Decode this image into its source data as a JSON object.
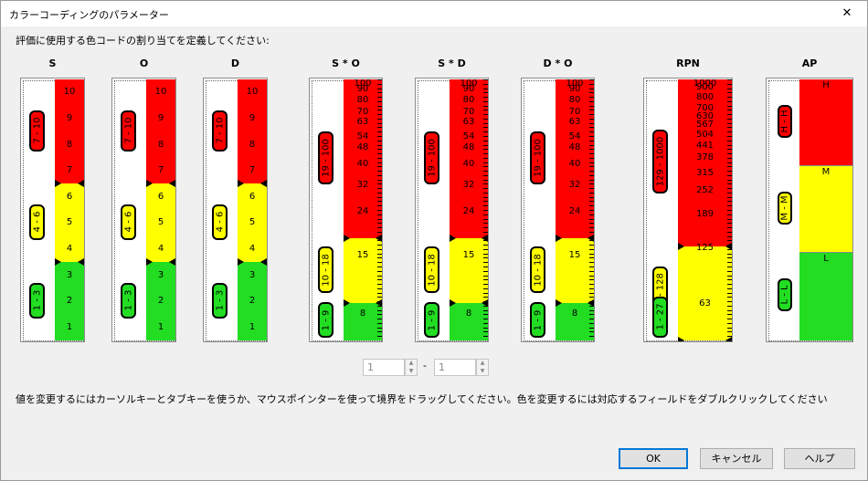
{
  "window": {
    "title": "カラーコーディングのパラメーター",
    "close_glyph": "✕"
  },
  "instruction": "評価に使用する色コードの割り当てを定義してください:",
  "colors": {
    "red": "#ff0000",
    "yellow": "#ffff00",
    "green": "#22dd22"
  },
  "scales": [
    {
      "name": "S",
      "max": 10,
      "min": 0,
      "segments": [
        {
          "from": 0,
          "to": 3,
          "color": "green"
        },
        {
          "from": 3,
          "to": 6,
          "color": "yellow"
        },
        {
          "from": 6,
          "to": 10,
          "color": "red"
        }
      ],
      "labels": [
        {
          "v": 0.5,
          "t": "1"
        },
        {
          "v": 1.5,
          "t": "2"
        },
        {
          "v": 2.5,
          "t": "3"
        },
        {
          "v": 3.5,
          "t": "4"
        },
        {
          "v": 4.5,
          "t": "5"
        },
        {
          "v": 5.5,
          "t": "6"
        },
        {
          "v": 6.5,
          "t": "7"
        },
        {
          "v": 7.5,
          "t": "8"
        },
        {
          "v": 8.5,
          "t": "9"
        },
        {
          "v": 9.5,
          "t": "10"
        }
      ],
      "ranges": [
        {
          "text": "7 - 10",
          "color": "red",
          "from": 6,
          "to": 10
        },
        {
          "text": "4 - 6",
          "color": "yellow",
          "from": 3,
          "to": 6
        },
        {
          "text": "1 - 3",
          "color": "green",
          "from": 0,
          "to": 3
        }
      ]
    },
    {
      "name": "O",
      "max": 10,
      "min": 0,
      "segments": [
        {
          "from": 0,
          "to": 3,
          "color": "green"
        },
        {
          "from": 3,
          "to": 6,
          "color": "yellow"
        },
        {
          "from": 6,
          "to": 10,
          "color": "red"
        }
      ],
      "labels": [
        {
          "v": 0.5,
          "t": "1"
        },
        {
          "v": 1.5,
          "t": "2"
        },
        {
          "v": 2.5,
          "t": "3"
        },
        {
          "v": 3.5,
          "t": "4"
        },
        {
          "v": 4.5,
          "t": "5"
        },
        {
          "v": 5.5,
          "t": "6"
        },
        {
          "v": 6.5,
          "t": "7"
        },
        {
          "v": 7.5,
          "t": "8"
        },
        {
          "v": 8.5,
          "t": "9"
        },
        {
          "v": 9.5,
          "t": "10"
        }
      ],
      "ranges": [
        {
          "text": "7 - 10",
          "color": "red",
          "from": 6,
          "to": 10
        },
        {
          "text": "4 - 6",
          "color": "yellow",
          "from": 3,
          "to": 6
        },
        {
          "text": "1 - 3",
          "color": "green",
          "from": 0,
          "to": 3
        }
      ]
    },
    {
      "name": "D",
      "max": 10,
      "min": 0,
      "segments": [
        {
          "from": 0,
          "to": 3,
          "color": "green"
        },
        {
          "from": 3,
          "to": 6,
          "color": "yellow"
        },
        {
          "from": 6,
          "to": 10,
          "color": "red"
        }
      ],
      "labels": [
        {
          "v": 0.5,
          "t": "1"
        },
        {
          "v": 1.5,
          "t": "2"
        },
        {
          "v": 2.5,
          "t": "3"
        },
        {
          "v": 3.5,
          "t": "4"
        },
        {
          "v": 4.5,
          "t": "5"
        },
        {
          "v": 5.5,
          "t": "6"
        },
        {
          "v": 6.5,
          "t": "7"
        },
        {
          "v": 7.5,
          "t": "8"
        },
        {
          "v": 8.5,
          "t": "9"
        },
        {
          "v": 9.5,
          "t": "10"
        }
      ],
      "ranges": [
        {
          "text": "7 - 10",
          "color": "red",
          "from": 6,
          "to": 10
        },
        {
          "text": "4 - 6",
          "color": "yellow",
          "from": 3,
          "to": 6
        },
        {
          "text": "1 - 3",
          "color": "green",
          "from": 0,
          "to": 3
        }
      ]
    },
    {
      "name": "S * O",
      "max": 100,
      "min": 0,
      "log": true,
      "segments": [
        {
          "from": 0,
          "to": 9,
          "color": "green"
        },
        {
          "from": 9,
          "to": 18,
          "color": "yellow"
        },
        {
          "from": 18,
          "to": 100,
          "color": "red"
        }
      ],
      "labels": [
        {
          "v": 100,
          "t": "100"
        },
        {
          "v": 90,
          "t": "90"
        },
        {
          "v": 80,
          "t": "80"
        },
        {
          "v": 70,
          "t": "70"
        },
        {
          "v": 63,
          "t": "63"
        },
        {
          "v": 54,
          "t": "54"
        },
        {
          "v": 48,
          "t": "48"
        },
        {
          "v": 40,
          "t": "40"
        },
        {
          "v": 32,
          "t": "32"
        },
        {
          "v": 24,
          "t": "24"
        },
        {
          "v": 15,
          "t": "15"
        },
        {
          "v": 8,
          "t": "8"
        }
      ],
      "ranges": [
        {
          "text": "19 - 100",
          "color": "red",
          "from": 18,
          "to": 100
        },
        {
          "text": "10 - 18",
          "color": "yellow",
          "from": 9,
          "to": 18
        },
        {
          "text": "1 - 9",
          "color": "green",
          "from": 0,
          "to": 9
        }
      ]
    },
    {
      "name": "S * D",
      "max": 100,
      "min": 0,
      "log": true,
      "segments": [
        {
          "from": 0,
          "to": 9,
          "color": "green"
        },
        {
          "from": 9,
          "to": 18,
          "color": "yellow"
        },
        {
          "from": 18,
          "to": 100,
          "color": "red"
        }
      ],
      "labels": [
        {
          "v": 100,
          "t": "100"
        },
        {
          "v": 90,
          "t": "90"
        },
        {
          "v": 80,
          "t": "80"
        },
        {
          "v": 70,
          "t": "70"
        },
        {
          "v": 63,
          "t": "63"
        },
        {
          "v": 54,
          "t": "54"
        },
        {
          "v": 48,
          "t": "48"
        },
        {
          "v": 40,
          "t": "40"
        },
        {
          "v": 32,
          "t": "32"
        },
        {
          "v": 24,
          "t": "24"
        },
        {
          "v": 15,
          "t": "15"
        },
        {
          "v": 8,
          "t": "8"
        }
      ],
      "ranges": [
        {
          "text": "19 - 100",
          "color": "red",
          "from": 18,
          "to": 100
        },
        {
          "text": "10 - 18",
          "color": "yellow",
          "from": 9,
          "to": 18
        },
        {
          "text": "1 - 9",
          "color": "green",
          "from": 0,
          "to": 9
        }
      ]
    },
    {
      "name": "D * O",
      "max": 100,
      "min": 0,
      "log": true,
      "segments": [
        {
          "from": 0,
          "to": 9,
          "color": "green"
        },
        {
          "from": 9,
          "to": 18,
          "color": "yellow"
        },
        {
          "from": 18,
          "to": 100,
          "color": "red"
        }
      ],
      "labels": [
        {
          "v": 100,
          "t": "100"
        },
        {
          "v": 90,
          "t": "90"
        },
        {
          "v": 80,
          "t": "80"
        },
        {
          "v": 70,
          "t": "70"
        },
        {
          "v": 63,
          "t": "63"
        },
        {
          "v": 54,
          "t": "54"
        },
        {
          "v": 48,
          "t": "48"
        },
        {
          "v": 40,
          "t": "40"
        },
        {
          "v": 32,
          "t": "32"
        },
        {
          "v": 24,
          "t": "24"
        },
        {
          "v": 15,
          "t": "15"
        },
        {
          "v": 8,
          "t": "8"
        }
      ],
      "ranges": [
        {
          "text": "19 - 100",
          "color": "red",
          "from": 18,
          "to": 100
        },
        {
          "text": "10 - 18",
          "color": "yellow",
          "from": 9,
          "to": 18
        },
        {
          "text": "1 - 9",
          "color": "green",
          "from": 0,
          "to": 9
        }
      ]
    },
    {
      "name": "RPN",
      "max": 1000,
      "min": 0,
      "log": true,
      "segments": [
        {
          "from": 0,
          "to": 27,
          "color": "green"
        },
        {
          "from": 27,
          "to": 128,
          "color": "yellow"
        },
        {
          "from": 128,
          "to": 1000,
          "color": "red"
        }
      ],
      "labels": [
        {
          "v": 1000,
          "t": "1000"
        },
        {
          "v": 900,
          "t": "900"
        },
        {
          "v": 800,
          "t": "800"
        },
        {
          "v": 700,
          "t": "700"
        },
        {
          "v": 630,
          "t": "630"
        },
        {
          "v": 567,
          "t": "567"
        },
        {
          "v": 504,
          "t": "504"
        },
        {
          "v": 441,
          "t": "441"
        },
        {
          "v": 378,
          "t": "378"
        },
        {
          "v": 315,
          "t": "315"
        },
        {
          "v": 252,
          "t": "252"
        },
        {
          "v": 189,
          "t": "189"
        },
        {
          "v": 125,
          "t": "125"
        },
        {
          "v": 63,
          "t": "63"
        }
      ],
      "ranges": [
        {
          "text": "129 - 1000",
          "color": "red",
          "from": 128,
          "to": 1000
        },
        {
          "text": "28 - 128",
          "color": "yellow",
          "from": 27,
          "to": 128
        },
        {
          "text": "1 - 27",
          "color": "green",
          "from": 0,
          "to": 27
        }
      ]
    },
    {
      "name": "AP",
      "categorical": true,
      "segments": [
        {
          "label": "H",
          "color": "red"
        },
        {
          "label": "M",
          "color": "yellow"
        },
        {
          "label": "L",
          "color": "green"
        }
      ],
      "ranges": [
        {
          "text": "H - H",
          "color": "red"
        },
        {
          "text": "M - M",
          "color": "yellow"
        },
        {
          "text": "L - L",
          "color": "green"
        }
      ]
    }
  ],
  "range_editor": {
    "from_value": "1",
    "to_value": "1",
    "separator": "-",
    "spin_up": "▲",
    "spin_down": "▼"
  },
  "hint": "値を変更するにはカーソルキーとタブキーを使うか、マウスポインターを使って境界をドラッグしてください。色を変更するには対応するフィールドをダブルクリックしてください",
  "buttons": {
    "ok": "OK",
    "cancel": "キャンセル",
    "help": "ヘルプ"
  }
}
